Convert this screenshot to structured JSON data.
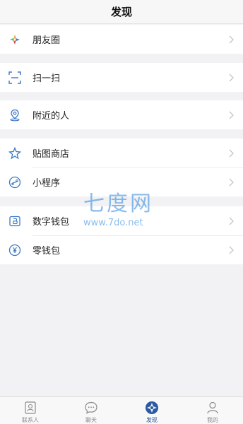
{
  "header": {
    "title": "发现"
  },
  "menu_groups": [
    {
      "items": [
        {
          "label": "朋友圈",
          "icon": "moments-icon"
        }
      ]
    },
    {
      "items": [
        {
          "label": "扫一扫",
          "icon": "scan-icon"
        }
      ]
    },
    {
      "items": [
        {
          "label": "附近的人",
          "icon": "location-pin-icon"
        }
      ]
    },
    {
      "items": [
        {
          "label": "贴图商店",
          "icon": "sticker-star-icon"
        },
        {
          "label": "小程序",
          "icon": "mini-program-icon"
        }
      ]
    },
    {
      "items": [
        {
          "label": "数字钱包",
          "icon": "digital-wallet-icon"
        },
        {
          "label": "零钱包",
          "icon": "yuan-coin-icon"
        }
      ]
    }
  ],
  "watermark": {
    "top": "七度网",
    "bottom": "www.7do.net"
  },
  "tabbar": {
    "tabs": [
      {
        "label": "联系人",
        "icon": "contacts-icon",
        "active": false
      },
      {
        "label": "聊天",
        "icon": "chat-icon",
        "active": false
      },
      {
        "label": "发现",
        "icon": "discover-icon",
        "active": true
      },
      {
        "label": "我的",
        "icon": "profile-icon",
        "active": false
      }
    ]
  },
  "colors": {
    "accent": "#2a5aa0",
    "icon_blue": "#3b78c8",
    "watermark": "#3b8fe0"
  }
}
